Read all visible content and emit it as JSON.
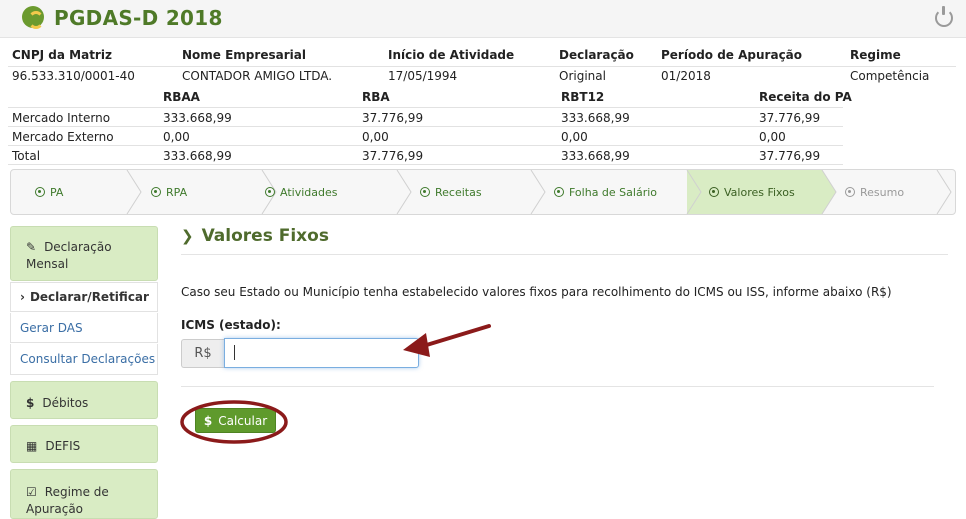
{
  "app": {
    "title": "PGDAS-D 2018"
  },
  "info": {
    "headers": [
      "CNPJ da Matriz",
      "Nome Empresarial",
      "Início de Atividade",
      "Declaração",
      "Período de Apuração",
      "Regime"
    ],
    "values": [
      "96.533.310/0001-40",
      "CONTADOR AMIGO LTDA.",
      "17/05/1994",
      "Original",
      "01/2018",
      "Competência"
    ]
  },
  "revenue": {
    "headers": [
      "RBAA",
      "RBA",
      "RBT12",
      "Receita do PA"
    ],
    "rows": [
      {
        "label": "Mercado Interno",
        "values": [
          "333.668,99",
          "37.776,99",
          "333.668,99",
          "37.776,99"
        ]
      },
      {
        "label": "Mercado Externo",
        "values": [
          "0,00",
          "0,00",
          "0,00",
          "0,00"
        ]
      },
      {
        "label": "Total",
        "values": [
          "333.668,99",
          "37.776,99",
          "333.668,99",
          "37.776,99"
        ]
      }
    ]
  },
  "steps": [
    "PA",
    "RPA",
    "Atividades",
    "Receitas",
    "Folha de Salário",
    "Valores Fixos",
    "Resumo"
  ],
  "sidebar": {
    "declaracao_mensal": "Declaração Mensal",
    "declarar_retificar": "Declarar/Retificar",
    "gerar_das": "Gerar DAS",
    "consultar": "Consultar Declarações",
    "debitos": "Débitos",
    "defis": "DEFIS",
    "regime": "Regime de Apuração"
  },
  "main": {
    "title": "Valores Fixos",
    "description": "Caso seu Estado ou Município tenha estabelecido valores fixos para recolhimento do ICMS ou ISS, informe abaixo (R$)",
    "icms_label": "ICMS (estado):",
    "currency": "R$",
    "icms_value": "",
    "calc_label": "Calcular"
  },
  "colors": {
    "brand_green": "#4f7a28",
    "active_step": "#d9ecc4",
    "button_green": "#5f9a2c",
    "annotation_red": "#8b1a1a"
  }
}
